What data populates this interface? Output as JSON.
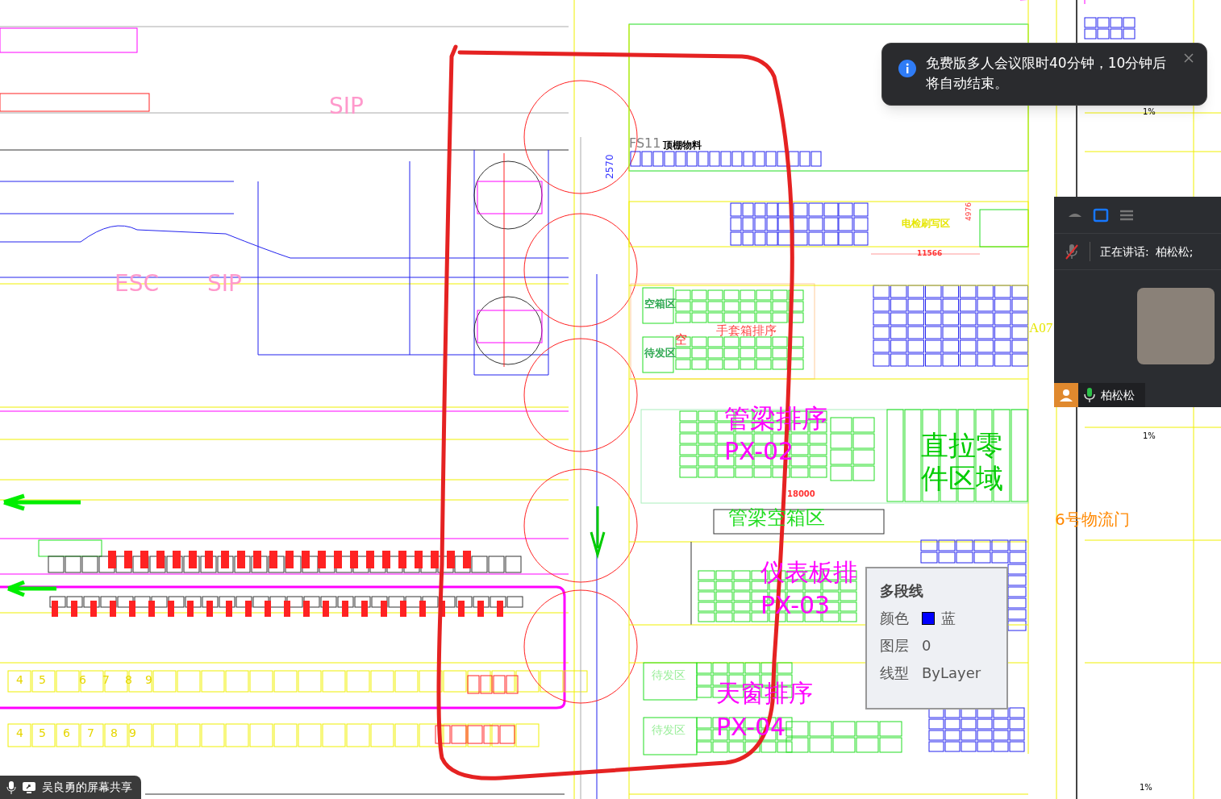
{
  "drawing": {
    "labels": [
      {
        "text": "FS11",
        "color": "#808080"
      },
      {
        "text": "顶棚物料",
        "color": "#000000"
      },
      {
        "text": "2570",
        "color": "#3333ff"
      },
      {
        "text": "电检刷写区",
        "color": "#e6e600"
      },
      {
        "text": "4976",
        "color": "#ff3333"
      },
      {
        "text": "11566",
        "color": "#ff3333"
      },
      {
        "text": "空箱区",
        "color": "#33aa55"
      },
      {
        "text": "待发区",
        "color": "#33aa55"
      },
      {
        "text": "手套箱排序",
        "color": "#ff4444"
      },
      {
        "text": "空",
        "color": "#ff2222"
      },
      {
        "text": "A07",
        "color": "#e6e600"
      },
      {
        "text": "管梁排序",
        "color": "#ff00ff"
      },
      {
        "text": "PX-02",
        "color": "#ff00ff"
      },
      {
        "text": "直拉零件区域",
        "color": "#00cc00"
      },
      {
        "text": "18000",
        "color": "#ff3333"
      },
      {
        "text": "管梁空箱区",
        "color": "#22dd22"
      },
      {
        "text": "仪表板排",
        "color": "#ff00ff"
      },
      {
        "text": "PX-03",
        "color": "#ff00ff"
      },
      {
        "text": "天窗排序",
        "color": "#ff00ff"
      },
      {
        "text": "PX-04",
        "color": "#ff00ff"
      },
      {
        "text": "待发区",
        "color": "#99ee99"
      },
      {
        "text": "待发区",
        "color": "#99ee99"
      },
      {
        "text": "6号物流门",
        "color": "#ff8800"
      },
      {
        "text": "1%",
        "color": "#000000"
      },
      {
        "text": "1%",
        "color": "#000000"
      },
      {
        "text": "1%",
        "color": "#000000"
      },
      {
        "text": "ESC",
        "color": "#ff99cc"
      },
      {
        "text": "SIP",
        "color": "#ff99cc"
      },
      {
        "text": "SIP",
        "color": "#ff99cc"
      }
    ],
    "slot_rows": [
      [
        "4",
        "5",
        "6",
        "7",
        "8",
        "9"
      ],
      [
        "4",
        "5",
        "6",
        "7",
        "8",
        "9"
      ]
    ]
  },
  "notification": {
    "text": "免费版多人会议限时40分钟，10分钟后将自动结束。"
  },
  "meeting_panel": {
    "view_modes": [
      {
        "selected": false
      },
      {
        "selected": true
      },
      {
        "selected": false
      }
    ],
    "mic_muted": true,
    "speaking_label": "正在讲话:",
    "speaker": "柏松松;",
    "video_name": "柏松松",
    "video_mic_on": true
  },
  "tooltip": {
    "title": "多段线",
    "rows": [
      {
        "label": "颜色",
        "value": "蓝",
        "color": "#0000ff"
      },
      {
        "label": "图层",
        "value": "0"
      },
      {
        "label": "线型",
        "value": "ByLayer"
      }
    ]
  },
  "share_bar": {
    "text": "吴良勇的屏幕共享"
  }
}
